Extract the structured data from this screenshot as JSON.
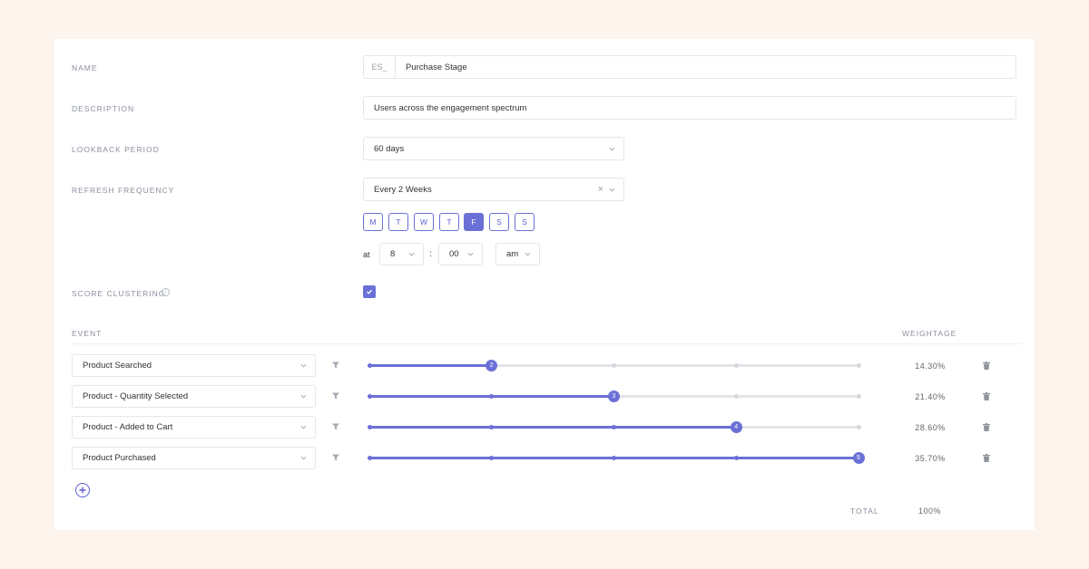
{
  "form": {
    "name_label": "NAME",
    "name_prefix": "ES_",
    "name_value": "Purchase Stage",
    "description_label": "DESCRIPTION",
    "description_value": "Users across the engagement spectrum",
    "lookback_label": "LOOKBACK PERIOD",
    "lookback_value": "60 days",
    "refresh_label": "REFRESH FREQUENCY",
    "refresh_value": "Every 2 Weeks",
    "clear_glyph": "×",
    "days": [
      {
        "label": "M",
        "selected": false
      },
      {
        "label": "T",
        "selected": false
      },
      {
        "label": "W",
        "selected": false
      },
      {
        "label": "T",
        "selected": false
      },
      {
        "label": "F",
        "selected": true
      },
      {
        "label": "S",
        "selected": false
      },
      {
        "label": "S",
        "selected": false
      }
    ],
    "time": {
      "at_label": "at",
      "hour": "8",
      "separator": ":",
      "minute": "00",
      "meridiem": "am"
    },
    "score_clustering_label": "SCORE CLUSTERING",
    "info_glyph": "i",
    "score_clustering_checked": true
  },
  "events": {
    "event_header": "EVENT",
    "weightage_header": "WEIGHTAGE",
    "slider_max": 5,
    "rows": [
      {
        "name": "Product Searched",
        "level": 2,
        "weight": "14.30%"
      },
      {
        "name": "Product - Quantity Selected",
        "level": 3,
        "weight": "21.40%"
      },
      {
        "name": "Product - Added to Cart",
        "level": 4,
        "weight": "28.60%"
      },
      {
        "name": "Product Purchased",
        "level": 5,
        "weight": "35.70%"
      }
    ],
    "total_label": "TOTAL",
    "total_value": "100%"
  },
  "colors": {
    "accent": "#6b70d6",
    "background": "#fdf4ee",
    "card": "#ffffff"
  },
  "icons": [
    "chevron-down-icon",
    "clear-icon",
    "info-icon",
    "check-icon",
    "filter-icon",
    "trash-icon",
    "add-circle-icon"
  ]
}
